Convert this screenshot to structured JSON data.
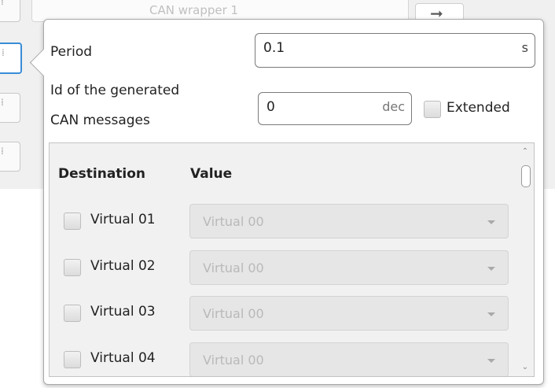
{
  "background": {
    "channel_label": "CAN wrapper 1",
    "arrow_glyph": "➞"
  },
  "popup": {
    "period": {
      "label": "Period",
      "value": "0.1",
      "unit": "s"
    },
    "id_field": {
      "label_line1": "Id of the generated",
      "label_line2": "CAN messages",
      "value": "0",
      "unit": "dec"
    },
    "extended": {
      "label": "Extended",
      "checked": false
    },
    "table": {
      "headers": {
        "destination": "Destination",
        "value": "Value"
      },
      "rows": [
        {
          "destination": "Virtual 01",
          "value": "Virtual 00"
        },
        {
          "destination": "Virtual 02",
          "value": "Virtual 00"
        },
        {
          "destination": "Virtual 03",
          "value": "Virtual 00"
        },
        {
          "destination": "Virtual 04",
          "value": "Virtual 00"
        }
      ]
    }
  }
}
